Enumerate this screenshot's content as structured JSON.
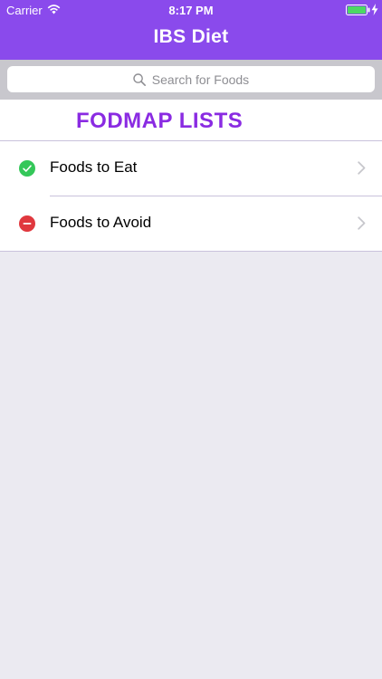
{
  "status_bar": {
    "carrier": "Carrier",
    "time": "8:17 PM",
    "wifi_icon": "wifi-icon",
    "battery_icon": "battery-icon",
    "charging_icon": "bolt-icon"
  },
  "nav": {
    "title": "IBS Diet"
  },
  "search": {
    "placeholder": "Search for Foods",
    "icon": "search-icon"
  },
  "section": {
    "title": "FODMAP LISTS"
  },
  "rows": [
    {
      "label": "Foods to Eat",
      "icon": "check-icon",
      "color": "#34c759"
    },
    {
      "label": "Foods to Avoid",
      "icon": "minus-icon",
      "color": "#e0383e"
    }
  ],
  "colors": {
    "accent": "#8a4aec",
    "section_title": "#8a2be2"
  }
}
